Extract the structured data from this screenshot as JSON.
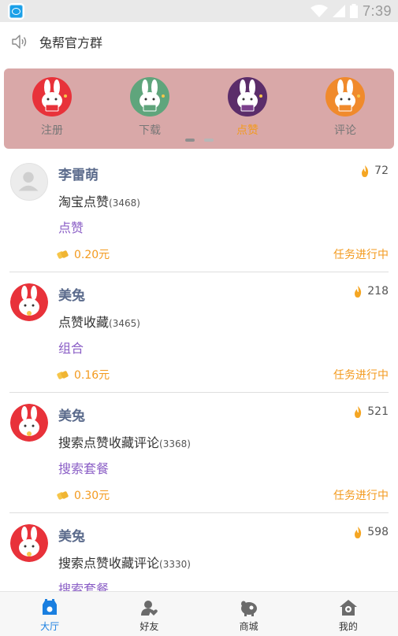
{
  "status_bar": {
    "time": "7:39",
    "app_icon": "app-notification-icon",
    "icons": [
      "wifi-icon",
      "signal-icon",
      "battery-icon"
    ]
  },
  "notice": {
    "icon": "speaker-icon",
    "text": "兔帮官方群"
  },
  "categories": [
    {
      "label": "注册",
      "color": "#e8323a",
      "active": false
    },
    {
      "label": "下载",
      "color": "#5fa57c",
      "active": false
    },
    {
      "label": "点赞",
      "color": "#5b2d6a",
      "active": true
    },
    {
      "label": "评论",
      "color": "#f08a2c",
      "active": false
    }
  ],
  "banner_page": {
    "current": 1,
    "total": 2
  },
  "tasks": [
    {
      "name": "李雷萌",
      "heat": "72",
      "title": "淘宝点赞",
      "task_id": "(3468)",
      "tag": "点赞",
      "reward": "0.20元",
      "status": "任务进行中",
      "avatar": "default"
    },
    {
      "name": "美兔",
      "heat": "218",
      "title": "点赞收藏",
      "task_id": "(3465)",
      "tag": "组合",
      "reward": "0.16元",
      "status": "任务进行中",
      "avatar": "rabbit"
    },
    {
      "name": "美兔",
      "heat": "521",
      "title": "搜索点赞收藏评论",
      "task_id": "(3368)",
      "tag": "搜索套餐",
      "reward": "0.30元",
      "status": "任务进行中",
      "avatar": "rabbit"
    },
    {
      "name": "美兔",
      "heat": "598",
      "title": "搜索点赞收藏评论",
      "task_id": "(3330)",
      "tag": "搜索套餐",
      "reward": "",
      "status": "",
      "avatar": "rabbit"
    }
  ],
  "bottom_nav": [
    {
      "label": "大厅",
      "icon": "hall-icon",
      "active": true
    },
    {
      "label": "好友",
      "icon": "friends-icon",
      "active": false
    },
    {
      "label": "商城",
      "icon": "shop-icon",
      "active": false
    },
    {
      "label": "我的",
      "icon": "profile-icon",
      "active": false
    }
  ],
  "colors": {
    "accent": "#f39a1e",
    "tag": "#8b5fc6",
    "name": "#5b6b8c",
    "banner_bg": "#d9a8a8",
    "nav_active": "#1a7fe0"
  }
}
